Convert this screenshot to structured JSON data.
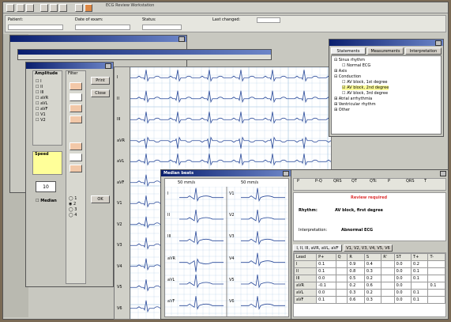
{
  "app": {
    "window_title": "ECG Review Workstation",
    "toolbar_icons": [
      "app-logo-icon",
      "open-icon",
      "save-icon",
      "print-icon",
      "zoom-icon",
      "settings-icon",
      "help-icon",
      "exit-icon"
    ]
  },
  "header": {
    "patient_label": "Patient:",
    "date_label": "Date of exam:",
    "status_label": "Status:",
    "last_changed_label": "Last changed:"
  },
  "leads": [
    "I",
    "II",
    "III",
    "aVR",
    "aVL",
    "aVF",
    "V1",
    "V2",
    "V3",
    "V4",
    "V5",
    "V6"
  ],
  "controls": {
    "panel_title": "Amplitude",
    "speed_title": "Speed",
    "filter_title": "Filter",
    "print_label": "Print",
    "close_label": "Close",
    "ok_label": "OK",
    "median_label": "Median",
    "value_display": "10",
    "radio_options": [
      "1",
      "2",
      "3",
      "4"
    ]
  },
  "tree": {
    "tabs": [
      "Statements",
      "Measurements",
      "Interpretation"
    ],
    "items": [
      "Sinus rhythm",
      "Normal ECG",
      "Axis",
      "Conduction",
      "AV block, 1st degree",
      "AV block, 2nd degree",
      "AV block, 3rd degree",
      "Atrial arrhythmia",
      "Ventricular rhythm",
      "Other"
    ]
  },
  "median_window": {
    "title": "Median beats",
    "col1_header": "50 mm/s",
    "col2_header": "50 mm/s"
  },
  "interpretation": {
    "columns": [
      "P",
      "P-Q",
      "QRS",
      "QT",
      "QTc",
      "P",
      "QRS",
      "T"
    ],
    "status_text": "Review required",
    "rhythm_label": "Rhythm:",
    "rhythm_text": "AV block, first degree",
    "interpretation_label": "Interpretation:",
    "interpretation_text": "Abnormal ECG"
  },
  "measurements": {
    "tabs": [
      "I, II, III, aVR, aVL, aVF",
      "V1, V2, V3, V4, V5, V6"
    ],
    "header": [
      "Lead",
      "P+",
      "Q",
      "R",
      "S",
      "R'",
      "ST",
      "T+",
      "T-"
    ],
    "rows": [
      [
        "I",
        "0.1",
        "",
        "0.9",
        "0.4",
        "",
        "0.0",
        "0.2",
        ""
      ],
      [
        "II",
        "0.1",
        "",
        "0.8",
        "0.3",
        "",
        "0.0",
        "0.1",
        ""
      ],
      [
        "III",
        "0.0",
        "",
        "0.5",
        "0.2",
        "",
        "0.0",
        "0.1",
        ""
      ],
      [
        "aVR",
        "-0.1",
        "",
        "0.2",
        "0.6",
        "",
        "0.0",
        "",
        "0.1"
      ],
      [
        "aVL",
        "0.0",
        "",
        "0.3",
        "0.2",
        "",
        "0.0",
        "0.1",
        ""
      ],
      [
        "aVF",
        "0.1",
        "",
        "0.6",
        "0.3",
        "",
        "0.0",
        "0.1",
        ""
      ]
    ]
  },
  "colors": {
    "titlebar": "#0a1f6e",
    "grid": "#b4cfe6",
    "trace": "#2a4a9a",
    "panel": "#c8c8c0",
    "highlight": "#ffff99"
  }
}
